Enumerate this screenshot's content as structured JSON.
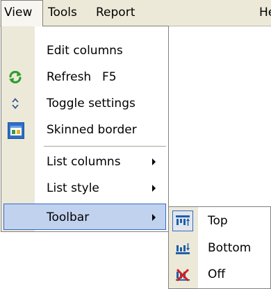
{
  "menubar": {
    "items": [
      {
        "label": "View"
      },
      {
        "label": "Tools"
      },
      {
        "label": "Report"
      },
      {
        "label": "He"
      }
    ]
  },
  "view_menu": {
    "items": [
      {
        "label": "Edit columns"
      },
      {
        "label": "Refresh",
        "shortcut": "F5",
        "icon": "refresh-icon"
      },
      {
        "label": "Toggle settings",
        "icon": "toggle-settings-icon"
      },
      {
        "label": "Skinned border",
        "icon": "skinned-border-icon"
      },
      {
        "label": "List columns",
        "submenu": true
      },
      {
        "label": "List style",
        "submenu": true
      },
      {
        "label": "Toolbar",
        "submenu": true,
        "highlighted": true
      }
    ]
  },
  "toolbar_submenu": {
    "items": [
      {
        "label": "Top",
        "icon": "toolbar-top-icon",
        "checked": true
      },
      {
        "label": "Bottom",
        "icon": "toolbar-bottom-icon"
      },
      {
        "label": "Off",
        "icon": "toolbar-off-icon"
      }
    ]
  },
  "colors": {
    "menu_gutter": "#ece9d8",
    "highlight_fill": "#c1d2ee",
    "highlight_border": "#316ac5"
  }
}
